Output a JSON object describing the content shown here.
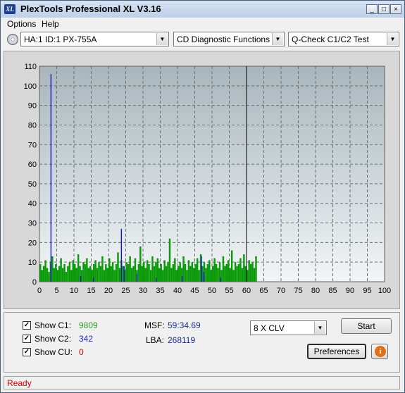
{
  "app": {
    "title": "PlexTools Professional XL V3.16",
    "icon_text": "XL",
    "title_buttons": {
      "minimize": "_",
      "maximize": "□",
      "close": "×"
    }
  },
  "menu": [
    {
      "label": "Options",
      "accel": "O"
    },
    {
      "label": "Help",
      "accel": "H"
    }
  ],
  "toolbar": {
    "drive_icon": "cd-drive-icon",
    "drive": "HA:1 ID:1  PX-755A",
    "function": "CD Diagnostic Functions",
    "test": "Q-Check C1/C2 Test",
    "dropdown_glyph": "▼"
  },
  "chart_data": {
    "type": "bar",
    "xlabel": "",
    "ylabel": "",
    "xlim": [
      0,
      100
    ],
    "ylim": [
      0,
      110
    ],
    "x_ticks": [
      0,
      5,
      10,
      15,
      20,
      25,
      30,
      35,
      40,
      45,
      50,
      55,
      60,
      65,
      70,
      75,
      80,
      85,
      90,
      95,
      100
    ],
    "y_ticks": [
      0,
      10,
      20,
      30,
      40,
      50,
      60,
      70,
      80,
      90,
      100,
      110
    ],
    "grid": true,
    "data_end_marker_x": 60,
    "colors": {
      "c1": "#0a9a0a",
      "c2": "#1515c8"
    },
    "series": [
      {
        "color": "#0a9a0a",
        "x_start": 0,
        "x_step": 0.5,
        "values": [
          9,
          6,
          8,
          11,
          7,
          5,
          10,
          13,
          7,
          9,
          6,
          8,
          12,
          7,
          9,
          5,
          8,
          10,
          6,
          11,
          9,
          7,
          14,
          8,
          6,
          10,
          9,
          12,
          7,
          8,
          6,
          9,
          11,
          7,
          10,
          8,
          13,
          6,
          9,
          7,
          12,
          8,
          10,
          6,
          9,
          15,
          7,
          11,
          8,
          6,
          10,
          9,
          13,
          7,
          8,
          12,
          6,
          9,
          18,
          8,
          10,
          7,
          11,
          9,
          6,
          13,
          8,
          10,
          12,
          7,
          9,
          6,
          11,
          8,
          10,
          22,
          7,
          9,
          12,
          6,
          8,
          10,
          7,
          13,
          9,
          6,
          11,
          8,
          10,
          7,
          9,
          12,
          6,
          14,
          8,
          10,
          7,
          9,
          11,
          6,
          8,
          12,
          9,
          7,
          10,
          6,
          13,
          8,
          9,
          11,
          7,
          16,
          6,
          10,
          8,
          9,
          12,
          7,
          14,
          8,
          6,
          11,
          9,
          10,
          7,
          13
        ]
      },
      {
        "color": "#1515c8",
        "points": [
          [
            3.2,
            106
          ],
          [
            11.8,
            3
          ],
          [
            15.5,
            2
          ],
          [
            23.6,
            27
          ],
          [
            24.4,
            8
          ],
          [
            28.1,
            4
          ],
          [
            33.7,
            2
          ],
          [
            41.2,
            3
          ],
          [
            46.8,
            13
          ],
          [
            47.5,
            5
          ],
          [
            52.3,
            2
          ]
        ]
      }
    ]
  },
  "stats": {
    "show_c1_label": "Show C1:",
    "show_c1": true,
    "c1_value": "9809",
    "show_c2_label": "Show C2:",
    "show_c2": true,
    "c2_value": "342",
    "show_cu_label": "Show CU:",
    "show_cu": true,
    "cu_value": "0",
    "msf_label": "MSF:",
    "msf_value": "59:34.69",
    "lba_label": "LBA:",
    "lba_value": "268119",
    "check_glyph": "✓"
  },
  "controls": {
    "speed": "8 X CLV",
    "start_label": "Start",
    "start_accel": "S",
    "preferences_label": "Preferences",
    "preferences_accel": "P",
    "info_icon": "info-icon",
    "info_glyph": "i"
  },
  "status": {
    "text": "Ready"
  }
}
